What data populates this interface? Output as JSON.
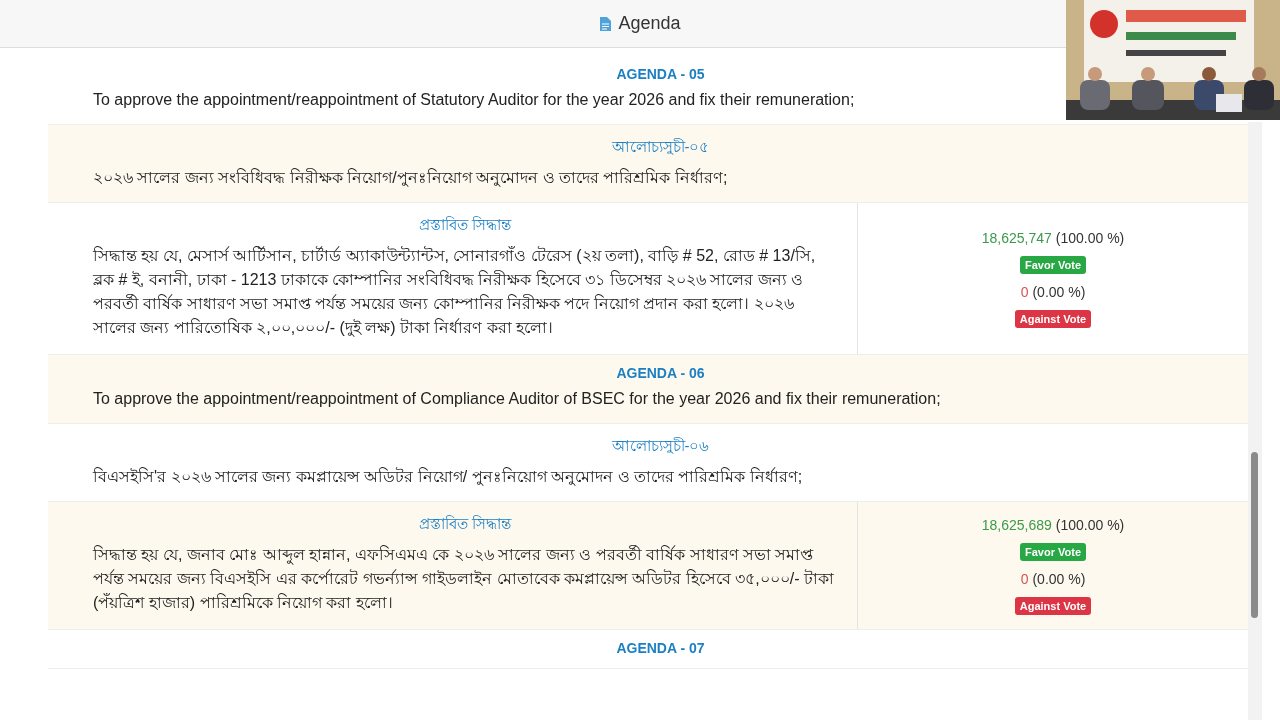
{
  "header": {
    "title": "Agenda"
  },
  "rows": [
    {
      "kind": "statement",
      "heading": "AGENDA - 05",
      "text": "To approve the appointment/reappointment of Statutory Auditor for the year 2026 and fix their remuneration;"
    },
    {
      "kind": "statement",
      "heading": "আলোচ্যসুচী-০৫",
      "text": "২০২৬ সালের জন্য সংবিধিবদ্ধ নিরীক্ষক নিয়োগ/পুনঃনিয়োগ অনুমোদন ও তাদের পারিশ্রমিক নির্ধারণ;"
    },
    {
      "kind": "decision",
      "heading": "প্রস্তাবিত সিদ্ধান্ত",
      "text": "সিদ্ধান্ত হয় যে, মেসার্স আর্টিসান, চার্টার্ড অ্যাকাউন্ট্যান্টস, সোনারগাঁও টেরেস (২য় তলা), বাড়ি # 52, রোড # 13/সি, ব্লক # ই, বনানী, ঢাকা - 1213 ঢাকাকে কোম্পানির সংবিধিবদ্ধ নিরীক্ষক হিসেবে ৩১ ডিসেম্বর ২০২৬ সালের জন্য ও পরবর্তী বার্ষিক সাধারণ সভা সমাপ্ত পর্যন্ত সময়ের জন্য কোম্পানির নিরীক্ষক পদে নিয়োগ প্রদান করা হলো। ২০২৬ সালের জন্য পারিতোষিক ২,০০,০০০/- (দুই লক্ষ) টাকা নির্ধারণ করা হলো।",
      "favor_count": "18,625,747",
      "favor_percent": "(100.00 %)",
      "favor_label": "Favor Vote",
      "against_count": "0",
      "against_percent": "(0.00 %)",
      "against_label": "Against Vote"
    },
    {
      "kind": "statement",
      "heading": "AGENDA - 06",
      "text": "To approve the appointment/reappointment of Compliance Auditor of BSEC for the year 2026 and fix their remuneration;"
    },
    {
      "kind": "statement",
      "heading": "আলোচ্যসুচী-০৬",
      "text": "বিএসইসি'র ২০২৬ সালের জন্য কমপ্লায়েন্স অডিটর নিয়োগ/ পুনঃনিয়োগ অনুমোদন ও তাদের পারিশ্রমিক নির্ধারণ;"
    },
    {
      "kind": "decision",
      "heading": "প্রস্তাবিত সিদ্ধান্ত",
      "text": "সিদ্ধান্ত হয় যে, জনাব মোঃ আব্দুল হান্নান, এফসিএমএ কে ২০২৬ সালের জন্য ও পরবর্তী বার্ষিক সাধারণ সভা সমাপ্ত পর্যন্ত সময়ের জন্য বিএসইসি এর কর্পোরেট গভর্ন্যান্স গাইডলাইন মোতাবেক কমপ্লায়েন্স অডিটর হিসেবে ৩৫,০০০/- টাকা (পঁয়ত্রিশ হাজার) পারিশ্রমিকে নিয়োগ করা হলো।",
      "favor_count": "18,625,689",
      "favor_percent": "(100.00 %)",
      "favor_label": "Favor Vote",
      "against_count": "0",
      "against_percent": "(0.00 %)",
      "against_label": "Against Vote"
    },
    {
      "kind": "statement",
      "heading": "AGENDA - 07"
    }
  ]
}
